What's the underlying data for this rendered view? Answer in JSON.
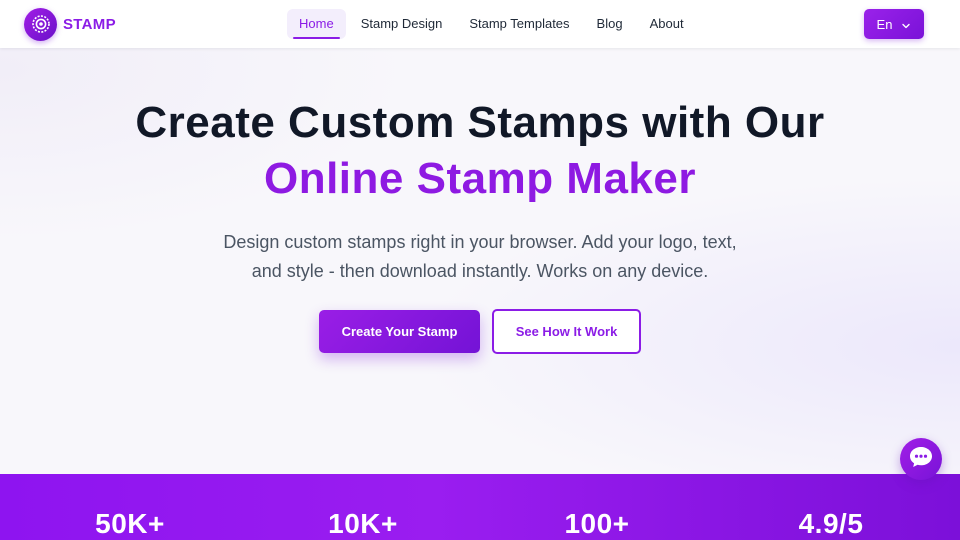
{
  "header": {
    "logo_text": "STAMP",
    "nav": [
      {
        "label": "Home",
        "active": true
      },
      {
        "label": "Stamp Design",
        "active": false
      },
      {
        "label": "Stamp Templates",
        "active": false
      },
      {
        "label": "Blog",
        "active": false
      },
      {
        "label": "About",
        "active": false
      }
    ],
    "language": "En"
  },
  "hero": {
    "title_line1": "Create Custom Stamps with Our",
    "title_line2": "Online Stamp Maker",
    "subtitle_line1": "Design custom stamps right in your browser. Add your logo, text,",
    "subtitle_line2": "and style - then download instantly. Works on any device.",
    "primary_cta": "Create Your Stamp",
    "secondary_cta": "See How It Work"
  },
  "stats": [
    "50K+",
    "10K+",
    "100+",
    "4.9/5"
  ],
  "icons": {
    "logo": "stamp-seal-icon",
    "language_dropdown": "chevron-down-icon",
    "chat": "chat-bubble-icon"
  },
  "colors": {
    "accent": "#8b1ce6",
    "accent_dark": "#7413d6",
    "heading": "#111827",
    "body_text": "#4b5563"
  }
}
